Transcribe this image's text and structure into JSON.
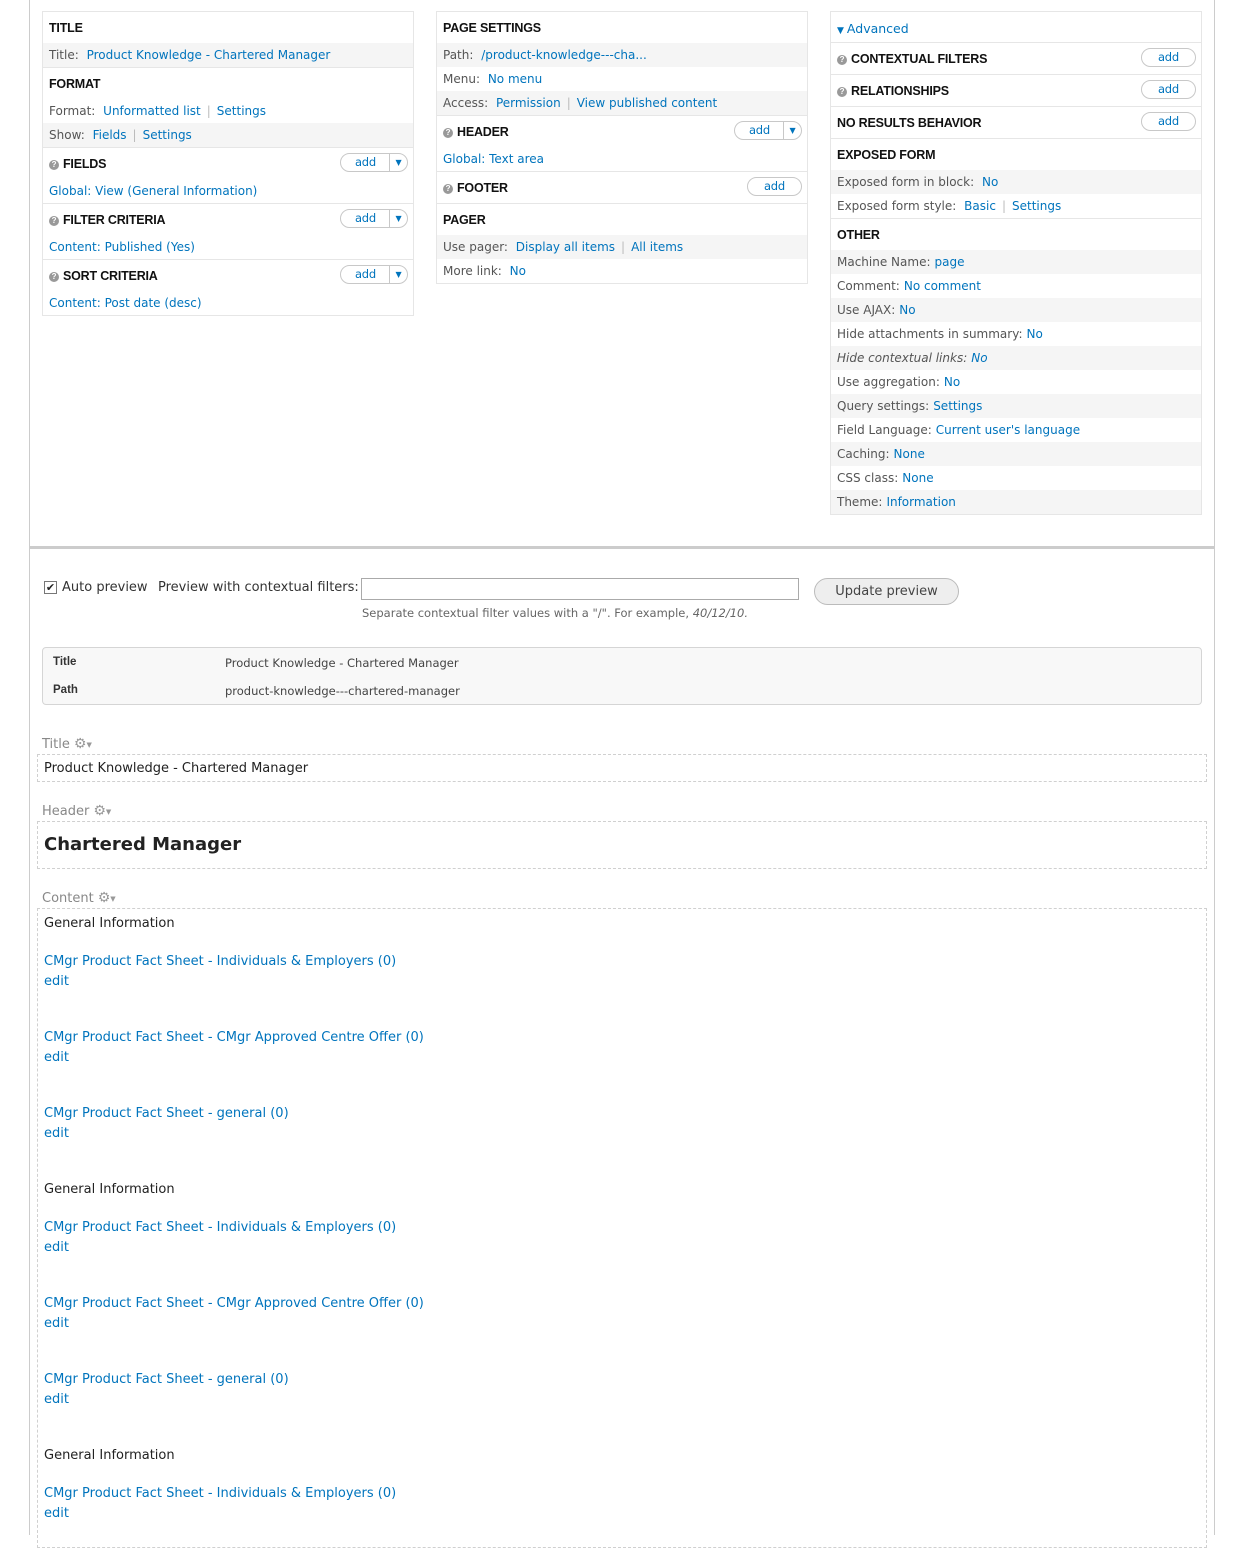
{
  "col1": {
    "title": {
      "heading": "TITLE",
      "label": "Title:",
      "value": "Product Knowledge - Chartered Manager"
    },
    "format": {
      "heading": "FORMAT",
      "format_label": "Format:",
      "format_value": "Unformatted list",
      "format_settings": "Settings",
      "show_label": "Show:",
      "show_value": "Fields",
      "show_settings": "Settings"
    },
    "fields": {
      "heading": "FIELDS",
      "add": "add",
      "item": "Global: View (General Information)"
    },
    "filter": {
      "heading": "FILTER CRITERIA",
      "add": "add",
      "item": "Content: Published (Yes)"
    },
    "sort": {
      "heading": "SORT CRITERIA",
      "add": "add",
      "item": "Content: Post date (desc)"
    }
  },
  "col2": {
    "page_settings": {
      "heading": "PAGE SETTINGS",
      "path_label": "Path:",
      "path_value": "/product-knowledge---cha...",
      "menu_label": "Menu:",
      "menu_value": "No menu",
      "access_label": "Access:",
      "access_value": "Permission",
      "access_value2": "View published content"
    },
    "header": {
      "heading": "HEADER",
      "add": "add",
      "item": "Global: Text area"
    },
    "footer": {
      "heading": "FOOTER",
      "add": "add"
    },
    "pager": {
      "heading": "PAGER",
      "use_label": "Use pager:",
      "use_value": "Display all items",
      "use_value2": "All items",
      "more_label": "More link:",
      "more_value": "No"
    }
  },
  "col3": {
    "advanced_toggle": "Advanced",
    "contextual": {
      "heading": "CONTEXTUAL FILTERS",
      "add": "add"
    },
    "relationships": {
      "heading": "RELATIONSHIPS",
      "add": "add"
    },
    "no_results": {
      "heading": "NO RESULTS BEHAVIOR",
      "add": "add"
    },
    "exposed": {
      "heading": "EXPOSED FORM",
      "block_label": "Exposed form in block:",
      "block_value": "No",
      "style_label": "Exposed form style:",
      "style_value": "Basic",
      "style_settings": "Settings"
    },
    "other": {
      "heading": "OTHER",
      "rows": [
        {
          "label": "Machine Name:",
          "value": "page"
        },
        {
          "label": "Comment:",
          "value": "No comment"
        },
        {
          "label": "Use AJAX:",
          "value": "No"
        },
        {
          "label": "Hide attachments in summary:",
          "value": "No"
        },
        {
          "label": "Hide contextual links:",
          "value": "No"
        },
        {
          "label": "Use aggregation:",
          "value": "No"
        },
        {
          "label": "Query settings:",
          "value": "Settings"
        },
        {
          "label": "Field Language:",
          "value": "Current user's language"
        },
        {
          "label": "Caching:",
          "value": "None"
        },
        {
          "label": "CSS class:",
          "value": "None"
        },
        {
          "label": "Theme:",
          "value": "Information"
        }
      ]
    }
  },
  "preview": {
    "checkmark": "✔",
    "auto_label": "Auto preview",
    "ctx_label": "Preview with contextual filters:",
    "ctx_value": "",
    "ctx_help_prefix": "Separate contextual filter values with a \"/\". For example,",
    "ctx_help_example": "40/12/10.",
    "update_label": "Update preview"
  },
  "info": {
    "title_key": "Title",
    "title_value": "Product Knowledge - Chartered Manager",
    "path_key": "Path",
    "path_value": "product-knowledge---chartered-manager"
  },
  "areas": {
    "gear_glyph": "⚙",
    "caret_glyph": "▼",
    "title_label": "Title",
    "title_content": "Product Knowledge - Chartered Manager",
    "header_label": "Header",
    "header_content": "Chartered Manager",
    "content_label": "Content"
  },
  "content": {
    "edit_label": "edit",
    "groups": [
      {
        "title": "General Information",
        "items": [
          "CMgr Product Fact Sheet - Individuals & Employers (0)",
          "CMgr Product Fact Sheet - CMgr Approved Centre Offer (0)",
          "CMgr Product Fact Sheet - general (0)"
        ]
      },
      {
        "title": "General Information",
        "items": [
          "CMgr Product Fact Sheet - Individuals & Employers (0)",
          "CMgr Product Fact Sheet - CMgr Approved Centre Offer (0)",
          "CMgr Product Fact Sheet - general (0)"
        ]
      },
      {
        "title": "General Information",
        "items": [
          "CMgr Product Fact Sheet - Individuals & Employers (0)"
        ]
      }
    ]
  },
  "colors": {
    "link": "#0074bd",
    "border": "#e6e6e6",
    "alt_row": "#f5f5f5"
  }
}
